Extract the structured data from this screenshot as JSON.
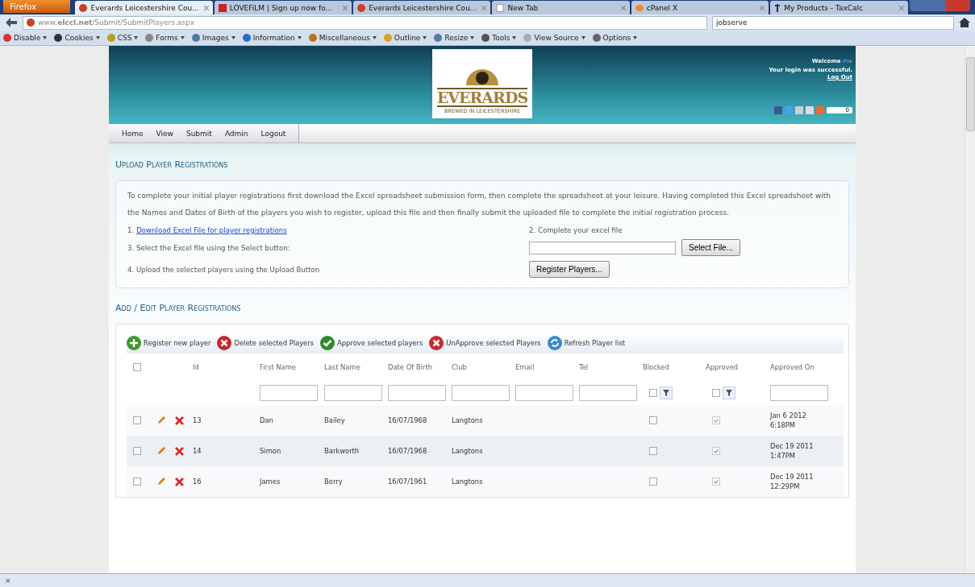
{
  "browser": {
    "app_button": "Firefox",
    "tabs": [
      {
        "title": "Everards Leicestershire Cou...",
        "selected": true,
        "kind": "ball"
      },
      {
        "title": "LOVEFiLM | Sign up now fo...",
        "selected": false,
        "kind": "lf"
      },
      {
        "title": "Everards Leicestershire Cou...",
        "selected": false,
        "kind": "ball"
      },
      {
        "title": "New Tab",
        "selected": false,
        "kind": "page"
      },
      {
        "title": "cPanel X",
        "selected": false,
        "kind": "cloud"
      },
      {
        "title": "My Products - TaxCalc",
        "selected": false,
        "kind": "t"
      }
    ],
    "url": "www.**elccl.net**/Submit/SubmitPlayers.aspx",
    "search": "jobserve",
    "toolbar": [
      "Disable",
      "Cookies",
      "CSS",
      "Forms",
      "Images",
      "Information",
      "Miscellaneous",
      "Outline",
      "Resize",
      "Tools",
      "View Source",
      "Options"
    ],
    "status": "×"
  },
  "header": {
    "logo": "EVERARDS",
    "logo_sub": "BREWED IN LEICESTERSHIRE",
    "welcome": "Welcome",
    "user": "mw",
    "login_message": "Your login was successful.",
    "logout_link": "Log Out",
    "share_count": "0"
  },
  "nav": [
    "Home",
    "View",
    "Submit",
    "Admin",
    "Logout"
  ],
  "upload": {
    "heading": "Upload Player Registrations",
    "intro": "To complete your initial player registrations first download the Excel spreadsheet submission form, then complete the spreadsheet at your leisure. Having completed this Excel spreadsheet with the Names and Dates of Birth of the players you wish to register, upload this file and then finally submit the uploaded file to complete the initial registration process.",
    "step1_prefix": "1.",
    "step1_link": "Download Excel File for player registrations",
    "step2": "2. Complete your excel file",
    "step3": "3. Select the Excel file using the Select button:",
    "select_button": "Select File...",
    "step4": "4. Upload the selected players using the Upload Button",
    "register_button": "Register Players..."
  },
  "players": {
    "heading": "Add / Edit Player Registrations",
    "actions": [
      {
        "label": "Register new player",
        "kind": "add"
      },
      {
        "label": "Delete selected Players",
        "kind": "delete"
      },
      {
        "label": "Approve selected players",
        "kind": "approve"
      },
      {
        "label": "UnApprove selected Players",
        "kind": "delete"
      },
      {
        "label": "Refresh Player list",
        "kind": "refresh"
      }
    ],
    "select_all": {
      "checked": false
    },
    "blocked_filter": {
      "checked": false
    },
    "approved_filter": {
      "checked": false
    },
    "columns": [
      "Id",
      "First Name",
      "Last Name",
      "Date Of Birth",
      "Club",
      "Email",
      "Tel",
      "Blocked",
      "Approved",
      "Approved On"
    ],
    "rows": [
      {
        "selected": false,
        "id": "13",
        "first": "Dan",
        "last": "Bailey",
        "dob": "16/07/1968",
        "club": "Langtons",
        "blocked": false,
        "approved": true,
        "approved_on": "Jan 6 2012 6:18PM"
      },
      {
        "selected": false,
        "id": "14",
        "first": "Simon",
        "last": "Barkworth",
        "dob": "16/07/1968",
        "club": "Langtons",
        "blocked": false,
        "approved": true,
        "approved_on": "Dec 19 2011 1:47PM"
      },
      {
        "selected": false,
        "id": "16",
        "first": "James",
        "last": "Berry",
        "dob": "16/07/1961",
        "club": "Langtons",
        "blocked": false,
        "approved": true,
        "approved_on": "Dec 19 2011 12:29PM"
      }
    ]
  }
}
